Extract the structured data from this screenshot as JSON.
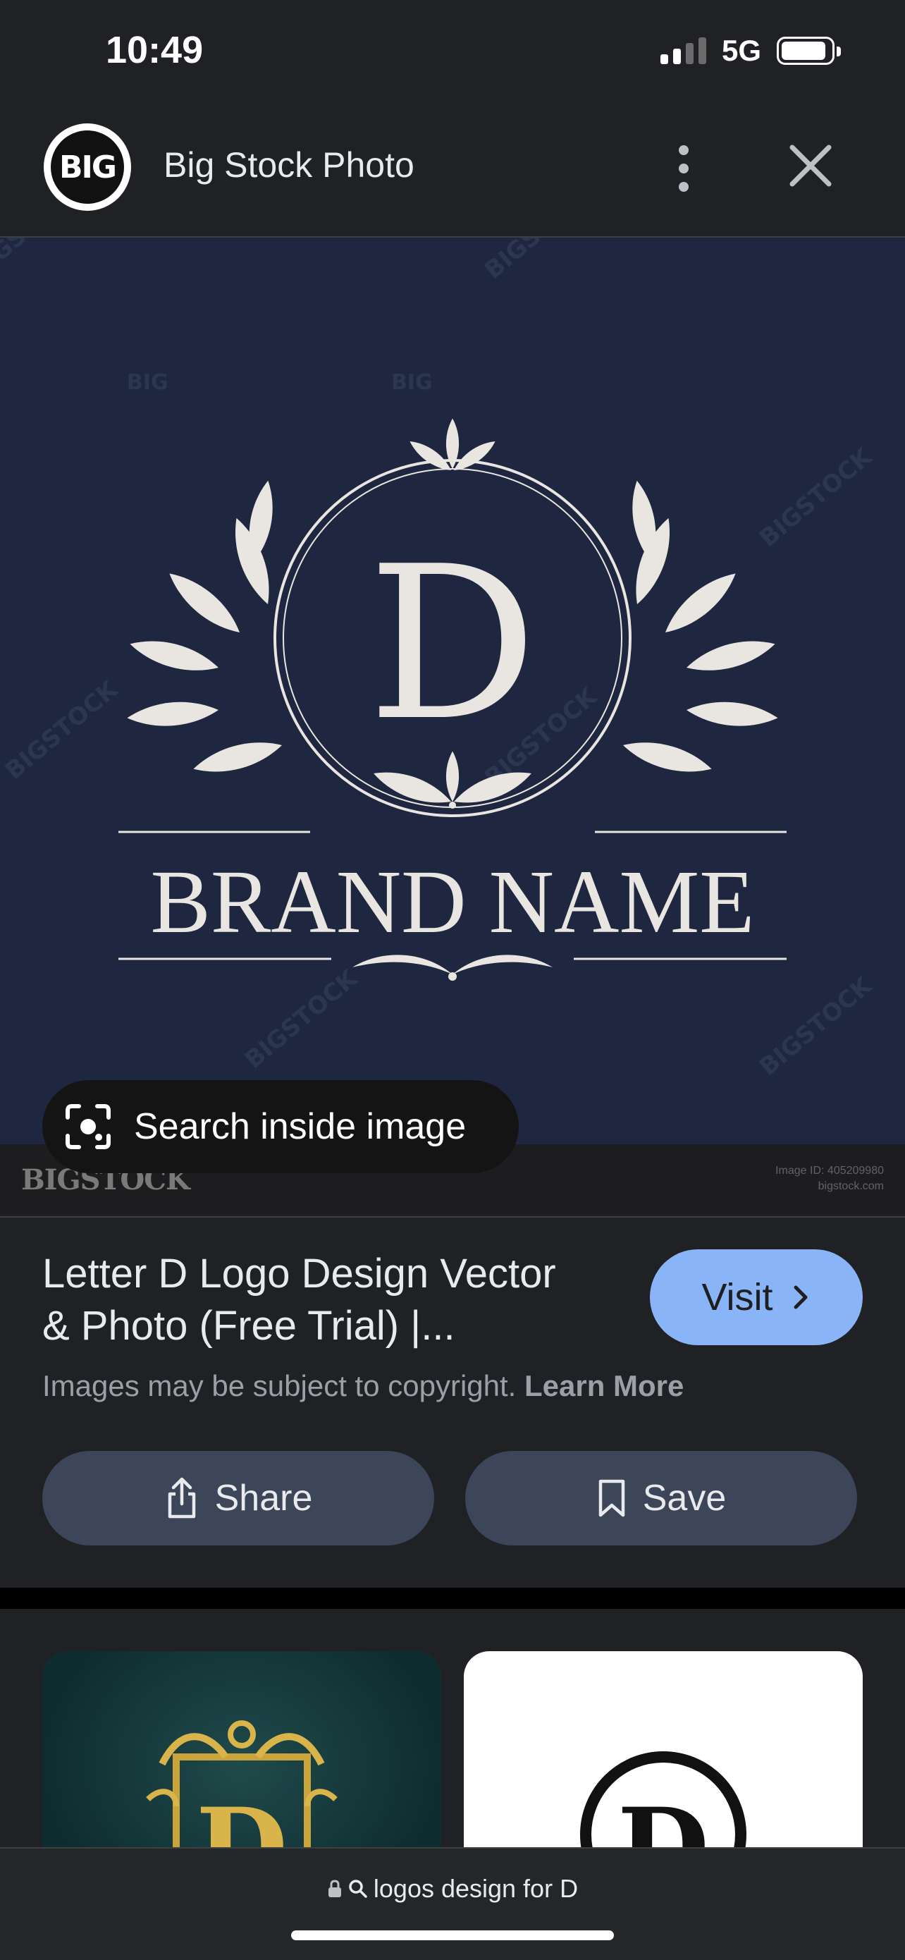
{
  "status_bar": {
    "time": "10:49",
    "network": "5G"
  },
  "header": {
    "site_name": "Big Stock Photo",
    "logo_text": "BIG"
  },
  "image": {
    "monogram": "D",
    "brand_text": "BRAND NAME",
    "watermark": "BIGSTOCK",
    "watermark_short": "BIG",
    "strip_logo": "BIGSTOCK",
    "strip_meta_1": "Image ID: 405209980",
    "strip_meta_2": "bigstock.com"
  },
  "search_inside": {
    "label": "Search inside image"
  },
  "result": {
    "title_line1": "Letter D Logo Design Vector",
    "title_line2": "& Photo (Free Trial) |...",
    "visit_label": "Visit",
    "copyright_text": "Images may be subject to copyright.",
    "learn_more": "Learn More"
  },
  "actions": {
    "share_label": "Share",
    "save_label": "Save"
  },
  "address_bar": {
    "url": "logos design for D"
  },
  "colors": {
    "accent": "#8ab4f8",
    "background": "#202124",
    "button": "#3c4658",
    "hero": "#1f2740"
  }
}
